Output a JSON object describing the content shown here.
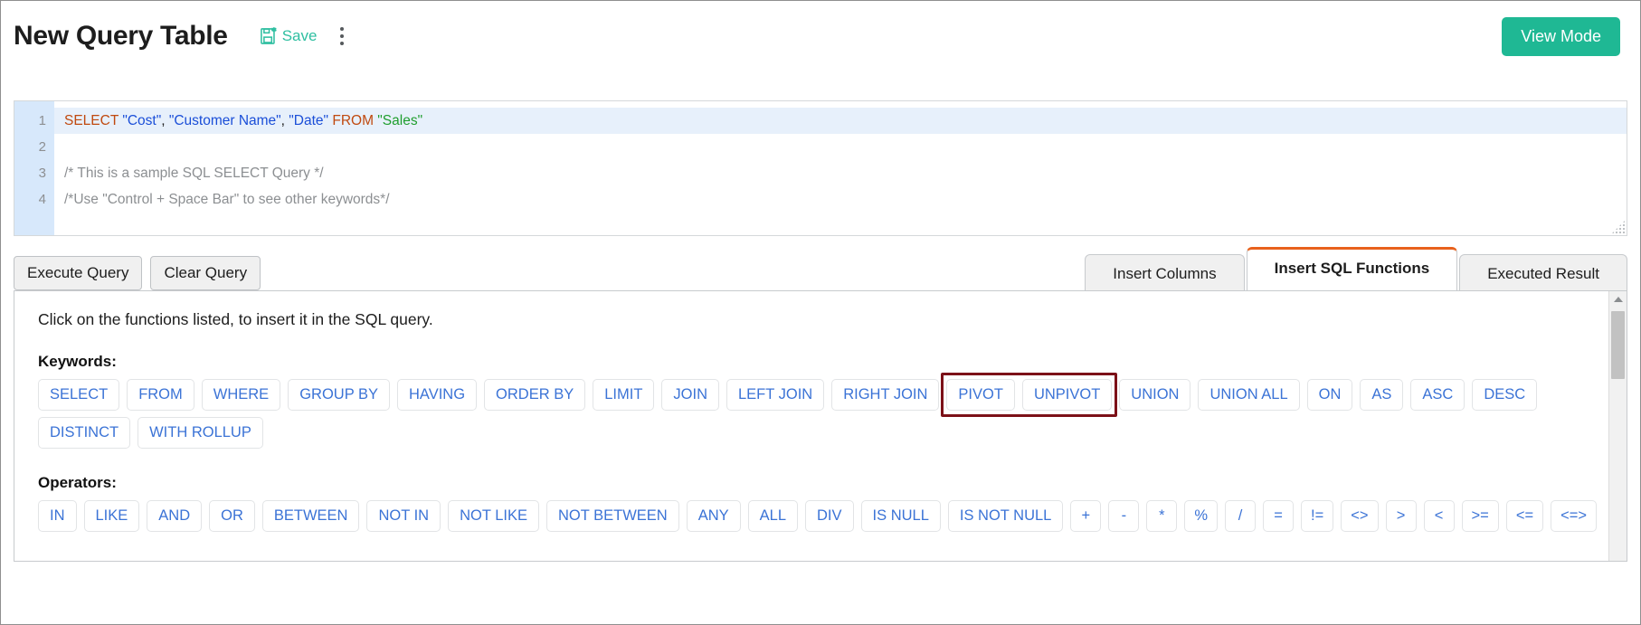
{
  "header": {
    "title": "New Query Table",
    "save_label": "Save",
    "save_icon": "floppy-disk-star-icon",
    "kebab_icon": "more-options-vertical-icon",
    "view_mode_label": "View Mode",
    "accent_green": "#1fb894",
    "save_text_color": "#2fbfa1"
  },
  "editor": {
    "line_numbers": [
      "1",
      "2",
      "3",
      "4"
    ],
    "lines": [
      {
        "n": "1",
        "active": true,
        "tokens": [
          {
            "text": "SELECT ",
            "type": "keyword"
          },
          {
            "text": "\"Cost\"",
            "type": "column"
          },
          {
            "text": ", ",
            "type": "punct"
          },
          {
            "text": "\"Customer Name\"",
            "type": "column"
          },
          {
            "text": ", ",
            "type": "punct"
          },
          {
            "text": "\"Date\"",
            "type": "column"
          },
          {
            "text": " ",
            "type": "punct"
          },
          {
            "text": "FROM ",
            "type": "keyword"
          },
          {
            "text": "\"Sales\"",
            "type": "table"
          }
        ]
      },
      {
        "n": "2",
        "active": false,
        "tokens": []
      },
      {
        "n": "3",
        "active": false,
        "tokens": [
          {
            "text": "/* This is a sample SQL SELECT Query */",
            "type": "comment"
          }
        ]
      },
      {
        "n": "4",
        "active": false,
        "tokens": [
          {
            "text": "/*Use \"Control + Space Bar\" to see other keywords*/",
            "type": "comment"
          }
        ]
      }
    ],
    "resize_grip_icon": "resize-handle-icon",
    "colors": {
      "gutter_bg": "#d7e8fb",
      "active_line_bg": "#e7f0fb",
      "keyword": "#c0490f",
      "column_string": "#1a4ed8",
      "table_string": "#1f9e2e",
      "comment": "#8c8f92"
    }
  },
  "actions": {
    "execute_label": "Execute Query",
    "clear_label": "Clear Query"
  },
  "tabs": [
    {
      "label": "Insert Columns",
      "active": false
    },
    {
      "label": "Insert SQL Functions",
      "active": true
    },
    {
      "label": "Executed Result",
      "active": false
    }
  ],
  "tab_active_border_color": "#e8611c",
  "panel": {
    "hint": "Click on the functions listed, to insert it in the SQL query.",
    "keywords_title": "Keywords:",
    "keywords": [
      "SELECT",
      "FROM",
      "WHERE",
      "GROUP BY",
      "HAVING",
      "ORDER BY",
      "LIMIT",
      "JOIN",
      "LEFT JOIN",
      "RIGHT JOIN",
      "PIVOT",
      "UNPIVOT",
      "UNION",
      "UNION ALL",
      "ON",
      "AS",
      "ASC",
      "DESC",
      "DISTINCT",
      "WITH ROLLUP"
    ],
    "operators_title": "Operators:",
    "operators": [
      "IN",
      "LIKE",
      "AND",
      "OR",
      "BETWEEN",
      "NOT IN",
      "NOT LIKE",
      "NOT BETWEEN",
      "ANY",
      "ALL",
      "DIV",
      "IS NULL",
      "IS NOT NULL",
      "+",
      "-",
      "*",
      "%",
      "/",
      "=",
      "!=",
      "<>",
      ">",
      "<",
      ">=",
      "<=",
      "<=>"
    ],
    "highlight": {
      "targets": [
        "PIVOT",
        "UNPIVOT"
      ],
      "color": "#7c1118"
    },
    "chip_text_color": "#3b73d6"
  },
  "scrollbar": {
    "up_arrow_icon": "scroll-up-arrow-icon",
    "thumb_icon": "scroll-thumb"
  }
}
